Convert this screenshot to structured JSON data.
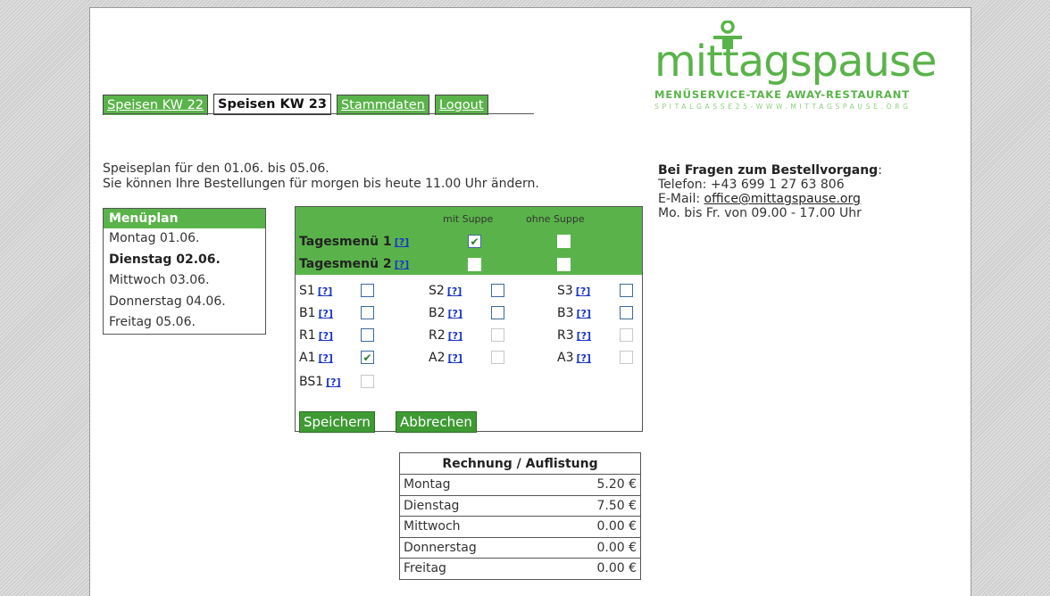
{
  "tabs": [
    {
      "label": "Speisen KW 22",
      "active": false
    },
    {
      "label": "Speisen KW 23",
      "active": true
    },
    {
      "label": "Stammdaten",
      "active": false
    },
    {
      "label": "Logout",
      "active": false
    }
  ],
  "logo": {
    "wordmark": "mittagspause",
    "tagline": "MENÜSERVICE-TAKE AWAY-RESTAURANT",
    "address": "SPITALGASSE25-WWW.MITTAGSPAUSE.ORG"
  },
  "intro": {
    "line1": "Speiseplan für den 01.06. bis 05.06.",
    "line2": "Sie können Ihre Bestellungen für morgen bis heute 11.00 Uhr ändern."
  },
  "info": {
    "heading": "Bei Fragen zum Bestellvorgang",
    "heading_suffix": ":",
    "phone": "Telefon: +43 699 1 27 63 806",
    "email_prefix": "E-Mail: ",
    "email": "office@mittagspause.org",
    "hours": "Mo. bis Fr. von 09.00 - 17.00 Uhr"
  },
  "menuplan": {
    "title": "Menüplan",
    "days": [
      {
        "label": "Montag 01.06.",
        "current": false
      },
      {
        "label": "Dienstag 02.06.",
        "current": true
      },
      {
        "label": "Mittwoch 03.06.",
        "current": false
      },
      {
        "label": "Donnerstag 04.06.",
        "current": false
      },
      {
        "label": "Freitag 05.06.",
        "current": false
      }
    ]
  },
  "order": {
    "col_with_soup": "mit Suppe",
    "col_without_soup": "ohne Suppe",
    "help_label": "[?]",
    "tagesmenu": [
      {
        "label": "Tagesmenü 1",
        "with_soup": true,
        "without_soup": false
      },
      {
        "label": "Tagesmenü 2",
        "with_soup": false,
        "without_soup": false
      }
    ],
    "items": [
      {
        "label": "S1",
        "checked": false,
        "enabled": true
      },
      {
        "label": "S2",
        "checked": false,
        "enabled": true
      },
      {
        "label": "S3",
        "checked": false,
        "enabled": true
      },
      {
        "label": "B1",
        "checked": false,
        "enabled": true
      },
      {
        "label": "B2",
        "checked": false,
        "enabled": true
      },
      {
        "label": "B3",
        "checked": false,
        "enabled": true
      },
      {
        "label": "R1",
        "checked": false,
        "enabled": true
      },
      {
        "label": "R2",
        "checked": false,
        "enabled": false
      },
      {
        "label": "R3",
        "checked": false,
        "enabled": false
      },
      {
        "label": "A1",
        "checked": true,
        "enabled": true
      },
      {
        "label": "A2",
        "checked": false,
        "enabled": false
      },
      {
        "label": "A3",
        "checked": false,
        "enabled": false
      },
      {
        "label": "BS1",
        "checked": false,
        "enabled": false
      }
    ],
    "save_label": "Speichern",
    "cancel_label": "Abbrechen"
  },
  "rechnung": {
    "title": "Rechnung / Auflistung",
    "rows": [
      {
        "day": "Montag",
        "amount": "5.20 €"
      },
      {
        "day": "Dienstag",
        "amount": "7.50 €"
      },
      {
        "day": "Mittwoch",
        "amount": "0.00 €"
      },
      {
        "day": "Donnerstag",
        "amount": "0.00 €"
      },
      {
        "day": "Freitag",
        "amount": "0.00 €"
      }
    ]
  },
  "colors": {
    "brand_green": "#5ab34a",
    "button_green": "#3f9a34",
    "help_link": "#1a36c8"
  }
}
